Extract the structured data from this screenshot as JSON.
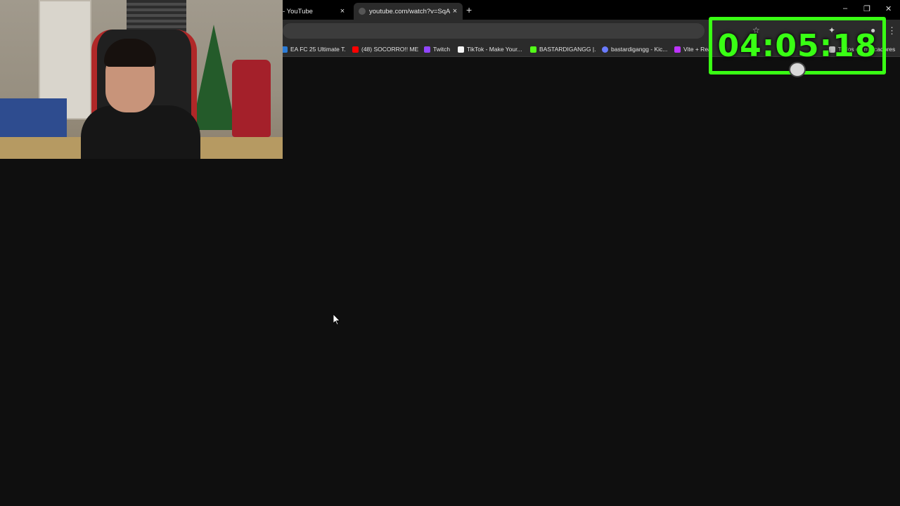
{
  "browser": {
    "tabs": [
      {
        "title": "- YouTube",
        "close": "×",
        "active": false
      },
      {
        "title": "youtube.com/watch?v=SqAGW",
        "close": "×",
        "active": true
      }
    ],
    "new_tab": "+",
    "window_controls": {
      "minimize": "–",
      "restore": "❐",
      "close": "✕"
    },
    "toolbar_icons": [
      "star-icon",
      "extension-icon",
      "profile-icon"
    ],
    "menu": "⋮",
    "bookmarks": [
      {
        "label": "EA FC 25 Ultimate T...",
        "icon_color": "#2b7bd6"
      },
      {
        "label": "(48) SOCORRO!! ME...",
        "icon_color": "#ff0000"
      },
      {
        "label": "Twitch",
        "icon_color": "#9146ff"
      },
      {
        "label": "TikTok - Make Your...",
        "icon_color": "#f5f5f5"
      },
      {
        "label": "BASTARDIGANGG |...",
        "icon_color": "#53fc18"
      },
      {
        "label": "bastardigangg - Kic...",
        "icon_color": "#6a7bff"
      },
      {
        "label": "Vite + Rea",
        "icon_color": "#bd34fe"
      },
      {
        "label": "Todos os marcadores",
        "icon_color": "#c0c0c0"
      }
    ]
  },
  "stream_overlay": {
    "timer": "04:05:18",
    "accent_color": "#39ff14"
  }
}
